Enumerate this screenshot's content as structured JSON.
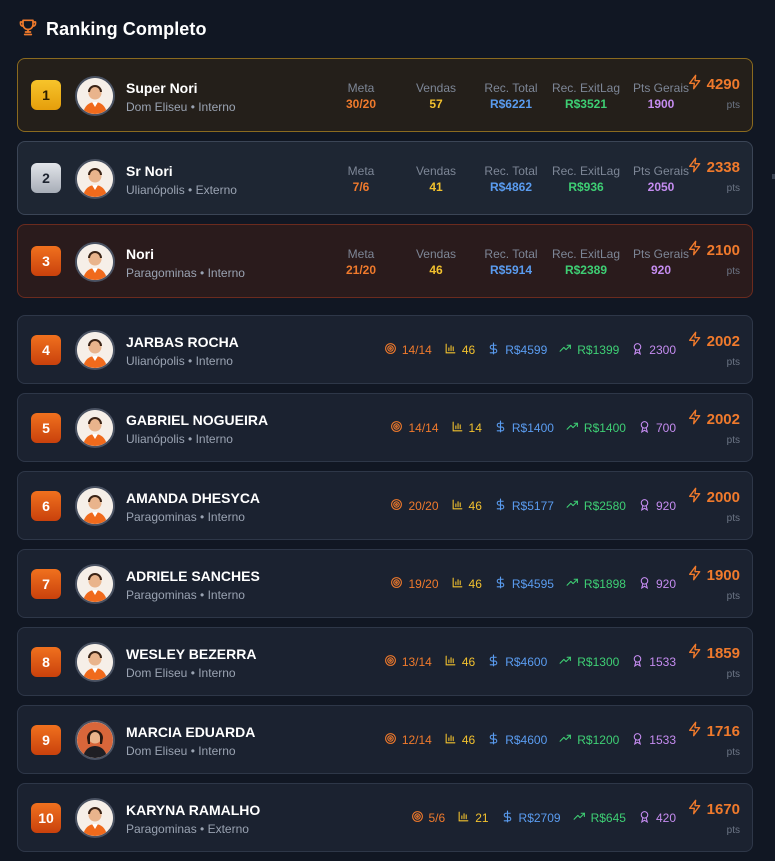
{
  "header": {
    "title": "Ranking Completo",
    "icon": "trophy-icon"
  },
  "colors": {
    "accent": "#f07a2c",
    "meta": "#f07a2c",
    "vendas": "#f2c12e",
    "rec": "#5a9cf0",
    "exit": "#3ecf74",
    "pts": "#c58cf0"
  },
  "labels": {
    "meta": "Meta",
    "vendas": "Vendas",
    "rec_total": "Rec. Total",
    "rec_exitlag": "Rec. ExitLag",
    "pts_gerais": "Pts Gerais",
    "pts_unit": "pts"
  },
  "top": [
    {
      "rank": "1",
      "name": "Super Nori",
      "sub": "Dom Eliseu • Interno",
      "meta": "30/20",
      "vendas": "57",
      "rec_total": "R$6221",
      "rec_exit": "R$3521",
      "pts_gerais": "1900",
      "points": "4290"
    },
    {
      "rank": "2",
      "name": "Sr Nori",
      "sub": "Ulianópolis • Externo",
      "meta": "7/6",
      "vendas": "41",
      "rec_total": "R$4862",
      "rec_exit": "R$936",
      "pts_gerais": "2050",
      "points": "2338"
    },
    {
      "rank": "3",
      "name": "Nori",
      "sub": "Paragominas • Interno",
      "meta": "21/20",
      "vendas": "46",
      "rec_total": "R$5914",
      "rec_exit": "R$2389",
      "pts_gerais": "920",
      "points": "2100"
    }
  ],
  "rest": [
    {
      "rank": "4",
      "name": "JARBAS ROCHA",
      "sub": "Ulianópolis • Interno",
      "meta": "14/14",
      "vendas": "46",
      "rec_total": "R$4599",
      "rec_exit": "R$1399",
      "pts_gerais": "2300",
      "points": "2002"
    },
    {
      "rank": "5",
      "name": "GABRIEL NOGUEIRA",
      "sub": "Ulianópolis • Interno",
      "meta": "14/14",
      "vendas": "14",
      "rec_total": "R$1400",
      "rec_exit": "R$1400",
      "pts_gerais": "700",
      "points": "2002"
    },
    {
      "rank": "6",
      "name": "AMANDA DHESYCA",
      "sub": "Paragominas • Interno",
      "meta": "20/20",
      "vendas": "46",
      "rec_total": "R$5177",
      "rec_exit": "R$2580",
      "pts_gerais": "920",
      "points": "2000"
    },
    {
      "rank": "7",
      "name": "ADRIELE SANCHES",
      "sub": "Paragominas • Interno",
      "meta": "19/20",
      "vendas": "46",
      "rec_total": "R$4595",
      "rec_exit": "R$1898",
      "pts_gerais": "920",
      "points": "1900"
    },
    {
      "rank": "8",
      "name": "WESLEY BEZERRA",
      "sub": "Dom Eliseu • Interno",
      "meta": "13/14",
      "vendas": "46",
      "rec_total": "R$4600",
      "rec_exit": "R$1300",
      "pts_gerais": "1533",
      "points": "1859"
    },
    {
      "rank": "9",
      "name": "MARCIA EDUARDA",
      "sub": "Dom Eliseu • Interno",
      "meta": "12/14",
      "vendas": "46",
      "rec_total": "R$4600",
      "rec_exit": "R$1200",
      "pts_gerais": "1533",
      "points": "1716"
    },
    {
      "rank": "10",
      "name": "KARYNA RAMALHO",
      "sub": "Paragominas • Externo",
      "meta": "5/6",
      "vendas": "21",
      "rec_total": "R$2709",
      "rec_exit": "R$645",
      "pts_gerais": "420",
      "points": "1670"
    }
  ]
}
